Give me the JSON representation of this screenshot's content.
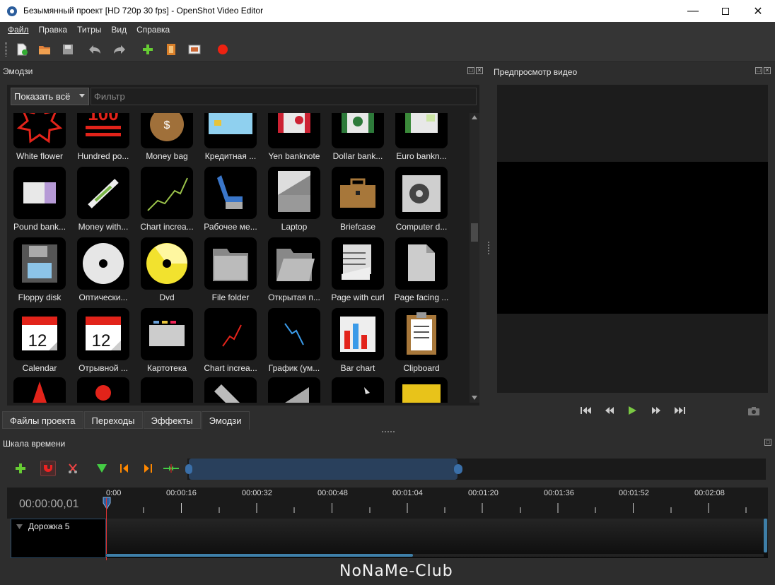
{
  "window": {
    "title": "Безымянный проект [HD 720p 30 fps] - OpenShot Video Editor"
  },
  "menu": [
    "Файл",
    "Правка",
    "Титры",
    "Вид",
    "Справка"
  ],
  "emoji_panel": {
    "title": "Эмодзи",
    "filter_select": "Показать всё",
    "filter_placeholder": "Фильтр",
    "items": [
      {
        "label": "White flower",
        "icon": "white-flower-icon"
      },
      {
        "label": "Hundred po...",
        "icon": "hundred-points-icon"
      },
      {
        "label": "Money bag",
        "icon": "money-bag-icon"
      },
      {
        "label": "Кредитная ...",
        "icon": "credit-card-icon"
      },
      {
        "label": "Yen banknote",
        "icon": "yen-banknote-icon"
      },
      {
        "label": "Dollar bank...",
        "icon": "dollar-banknote-icon"
      },
      {
        "label": "Euro bankn...",
        "icon": "euro-banknote-icon"
      },
      {
        "label": "Pound bank...",
        "icon": "pound-banknote-icon"
      },
      {
        "label": "Money with...",
        "icon": "money-with-wings-icon"
      },
      {
        "label": "Chart increa...",
        "icon": "chart-increasing-icon"
      },
      {
        "label": "Рабочее ме...",
        "icon": "seat-icon"
      },
      {
        "label": "Laptop",
        "icon": "laptop-icon"
      },
      {
        "label": "Briefcase",
        "icon": "briefcase-icon"
      },
      {
        "label": "Computer d...",
        "icon": "computer-disk-icon"
      },
      {
        "label": "Floppy disk",
        "icon": "floppy-disk-icon"
      },
      {
        "label": "Оптически...",
        "icon": "optical-disk-icon"
      },
      {
        "label": "Dvd",
        "icon": "dvd-icon"
      },
      {
        "label": "File folder",
        "icon": "file-folder-icon"
      },
      {
        "label": "Открытая п...",
        "icon": "open-folder-icon"
      },
      {
        "label": "Page with curl",
        "icon": "page-with-curl-icon"
      },
      {
        "label": "Page facing ...",
        "icon": "page-facing-up-icon"
      },
      {
        "label": "Calendar",
        "icon": "calendar-icon"
      },
      {
        "label": "Отрывной ...",
        "icon": "tear-off-calendar-icon"
      },
      {
        "label": "Картотека",
        "icon": "card-index-icon"
      },
      {
        "label": "Chart increa...",
        "icon": "chart-increasing-yen-icon"
      },
      {
        "label": "График (ум...",
        "icon": "chart-decreasing-icon"
      },
      {
        "label": "Bar chart",
        "icon": "bar-chart-icon"
      },
      {
        "label": "Clipboard",
        "icon": "clipboard-icon"
      }
    ],
    "calendar_day": "12"
  },
  "tabs": [
    "Файлы проекта",
    "Переходы",
    "Эффекты",
    "Эмодзи"
  ],
  "active_tab": "Эмодзи",
  "preview": {
    "title": "Предпросмотр видео"
  },
  "timeline": {
    "title": "Шкала времени",
    "timecode": "00:00:00,01",
    "ticks": [
      "0:00",
      "00:00:16",
      "00:00:32",
      "00:00:48",
      "00:01:04",
      "00:01:20",
      "00:01:36",
      "00:01:52",
      "00:02:08"
    ],
    "track_name": "Дорожка 5"
  },
  "watermark": "NoNaMe-Club",
  "colors": {
    "accent_blue": "#3e7fa8",
    "playhead": "#dd3333",
    "panel_bg": "#2d2d2d"
  }
}
